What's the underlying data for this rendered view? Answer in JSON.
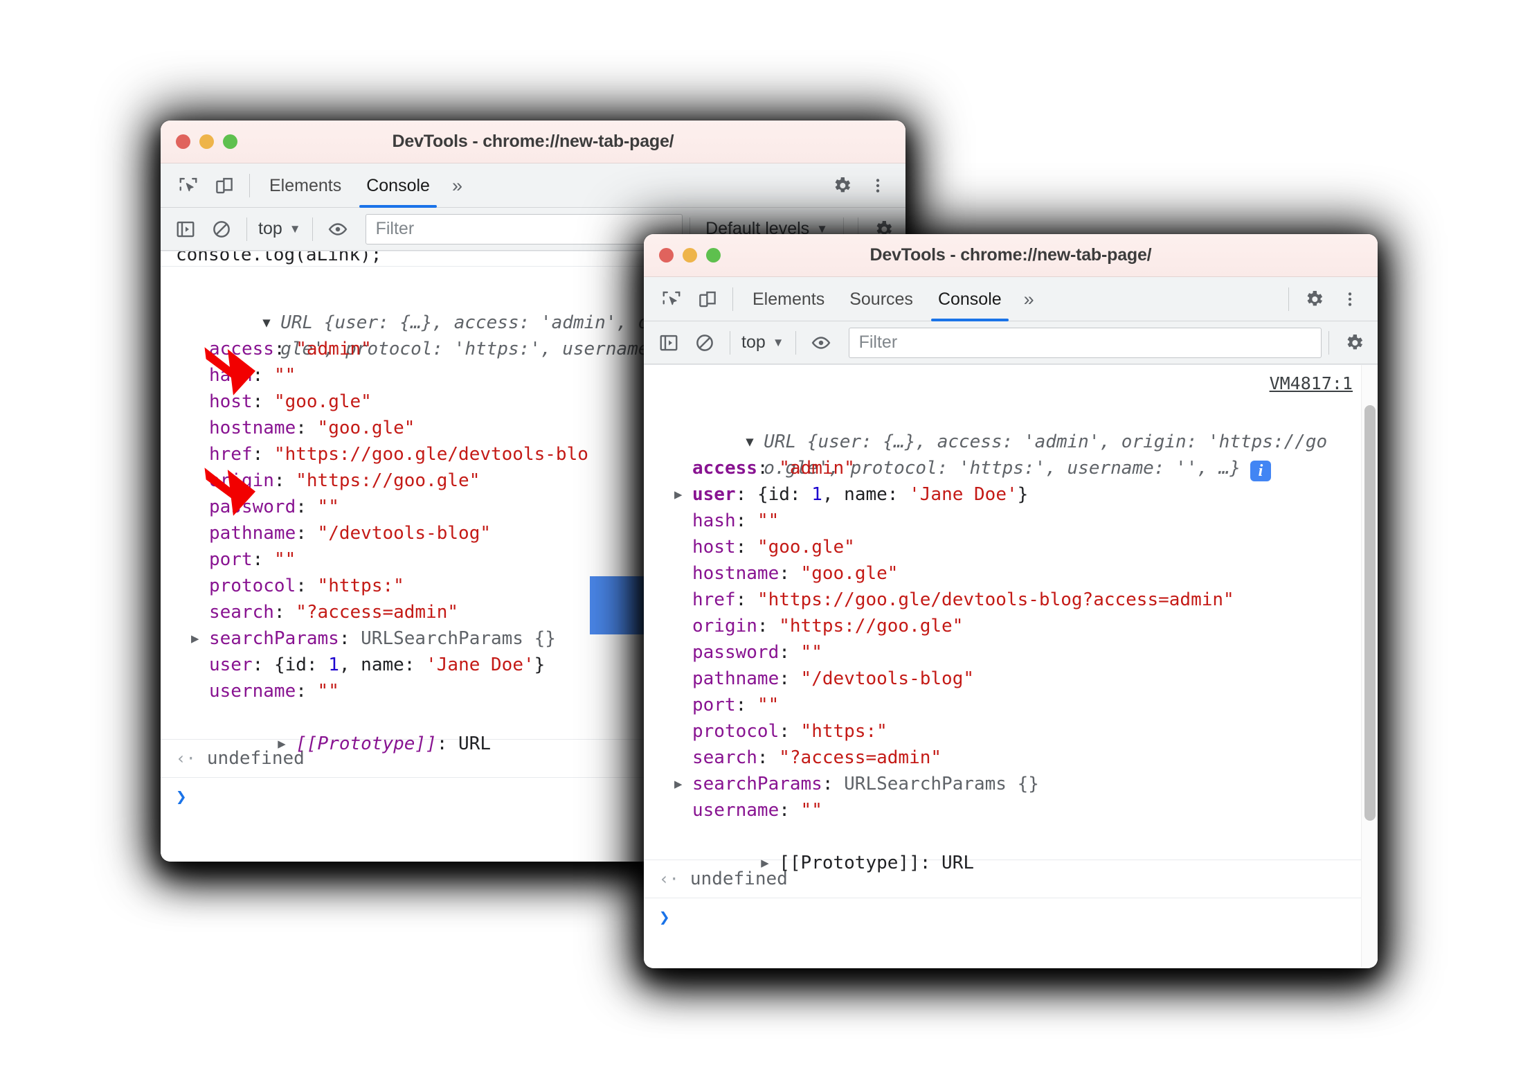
{
  "back_window": {
    "title": "DevTools - chrome://new-tab-page/",
    "traffic": {
      "close": "close-button",
      "minimize": "minimize-button",
      "zoom": "zoom-button"
    },
    "tabs": [
      {
        "label": "Elements",
        "active": false
      },
      {
        "label": "Console",
        "active": true
      }
    ],
    "more_tabs": "»",
    "toolbar": {
      "context": "top",
      "caret": "▼",
      "filter_placeholder": "Filter",
      "filter_value": "",
      "levels": "Default levels",
      "levels_caret": "▼"
    },
    "clipped_log": "console.log(aLink);",
    "console": {
      "preview_line1": "URL {user: {…}, access: 'admin', orig",
      "preview_line2": "gle', protocol: 'https:', username: '",
      "expand_triangle": "▼",
      "properties": [
        {
          "key": "access",
          "value": "\"admin\"",
          "type": "string",
          "arrow": true,
          "expand": false,
          "bold": false
        },
        {
          "key": "hash",
          "value": "\"\"",
          "type": "string",
          "arrow": false,
          "expand": false,
          "bold": false
        },
        {
          "key": "host",
          "value": "\"goo.gle\"",
          "type": "string",
          "arrow": false,
          "expand": false,
          "bold": false
        },
        {
          "key": "hostname",
          "value": "\"goo.gle\"",
          "type": "string",
          "arrow": false,
          "expand": false,
          "bold": false
        },
        {
          "key": "href",
          "value": "\"https://goo.gle/devtools-blo",
          "type": "string",
          "arrow": false,
          "expand": false,
          "bold": false
        },
        {
          "key": "origin",
          "value": "\"https://goo.gle\"",
          "type": "string",
          "arrow": false,
          "expand": false,
          "bold": false
        },
        {
          "key": "password",
          "value": "\"\"",
          "type": "string",
          "arrow": false,
          "expand": false,
          "bold": false
        },
        {
          "key": "pathname",
          "value": "\"/devtools-blog\"",
          "type": "string",
          "arrow": false,
          "expand": false,
          "bold": false
        },
        {
          "key": "port",
          "value": "\"\"",
          "type": "string",
          "arrow": false,
          "expand": false,
          "bold": false
        },
        {
          "key": "protocol",
          "value": "\"https:\"",
          "type": "string",
          "arrow": false,
          "expand": false,
          "bold": false
        },
        {
          "key": "search",
          "value": "\"?access=admin\"",
          "type": "string",
          "arrow": false,
          "expand": false,
          "bold": false
        },
        {
          "key": "searchParams",
          "value": "URLSearchParams {}",
          "type": "object",
          "arrow": false,
          "expand": true,
          "bold": false
        },
        {
          "key": "user",
          "value": "{id: 1, name: 'Jane Doe'}",
          "type": "inline-object",
          "arrow": true,
          "expand": false,
          "bold": false
        },
        {
          "key": "username",
          "value": "\"\"",
          "type": "string",
          "arrow": false,
          "expand": false,
          "bold": false
        }
      ],
      "prototype_key": "[[Prototype]]",
      "prototype_value": "URL",
      "prototype_italic": true,
      "result": "undefined",
      "result_arrow": "‹·",
      "prompt": "❯"
    }
  },
  "front_window": {
    "title": "DevTools - chrome://new-tab-page/",
    "tabs": [
      {
        "label": "Elements",
        "active": false
      },
      {
        "label": "Sources",
        "active": false
      },
      {
        "label": "Console",
        "active": true
      }
    ],
    "more_tabs": "»",
    "toolbar": {
      "context": "top",
      "caret": "▼",
      "filter_placeholder": "Filter",
      "filter_value": ""
    },
    "console": {
      "source_link": "VM4817:1",
      "preview_line1": "URL {user: {…}, access: 'admin', origin: 'https://go",
      "preview_line2": "o.gle', protocol: 'https:', username: '', …}",
      "info_badge": "i",
      "expand_triangle": "▼",
      "properties": [
        {
          "key": "access",
          "value": "\"admin\"",
          "type": "string",
          "expand": false,
          "bold": true
        },
        {
          "key": "user",
          "value": "{id: 1, name: 'Jane Doe'}",
          "type": "inline-object",
          "expand": true,
          "bold": true
        },
        {
          "key": "hash",
          "value": "\"\"",
          "type": "string",
          "expand": false,
          "bold": false
        },
        {
          "key": "host",
          "value": "\"goo.gle\"",
          "type": "string",
          "expand": false,
          "bold": false
        },
        {
          "key": "hostname",
          "value": "\"goo.gle\"",
          "type": "string",
          "expand": false,
          "bold": false
        },
        {
          "key": "href",
          "value": "\"https://goo.gle/devtools-blog?access=admin\"",
          "type": "string",
          "expand": false,
          "bold": false
        },
        {
          "key": "origin",
          "value": "\"https://goo.gle\"",
          "type": "string",
          "expand": false,
          "bold": false
        },
        {
          "key": "password",
          "value": "\"\"",
          "type": "string",
          "expand": false,
          "bold": false
        },
        {
          "key": "pathname",
          "value": "\"/devtools-blog\"",
          "type": "string",
          "expand": false,
          "bold": false
        },
        {
          "key": "port",
          "value": "\"\"",
          "type": "string",
          "expand": false,
          "bold": false
        },
        {
          "key": "protocol",
          "value": "\"https:\"",
          "type": "string",
          "expand": false,
          "bold": false
        },
        {
          "key": "search",
          "value": "\"?access=admin\"",
          "type": "string",
          "expand": false,
          "bold": false
        },
        {
          "key": "searchParams",
          "value": "URLSearchParams {}",
          "type": "object",
          "expand": true,
          "bold": false
        },
        {
          "key": "username",
          "value": "\"\"",
          "type": "string",
          "expand": false,
          "bold": false
        }
      ],
      "prototype_key": "[[Prototype]]",
      "prototype_value": "URL",
      "prototype_italic": false,
      "result": "undefined",
      "result_arrow": "‹·",
      "prompt": "❯"
    }
  },
  "annotations": {
    "red_arrow_color": "#f20000",
    "blue_arrow_color": "#4a86e8",
    "red_arrows": [
      {
        "target": "access-property-back"
      },
      {
        "target": "user-property-back"
      }
    ],
    "blue_arrow": {
      "direction": "right",
      "meaning": "transition-to-after-state"
    }
  },
  "colors": {
    "accent_blue": "#1a73e8",
    "property_purple": "#881391",
    "string_red": "#c41a16",
    "number_blue": "#1c00cf",
    "grey_text": "#5f6368",
    "titlebar_pink": "#fdf0ee",
    "toolbar_grey": "#f1f3f4",
    "traffic_red": "#e0635d",
    "traffic_yellow": "#eeb44a",
    "traffic_green": "#5ec04e"
  }
}
